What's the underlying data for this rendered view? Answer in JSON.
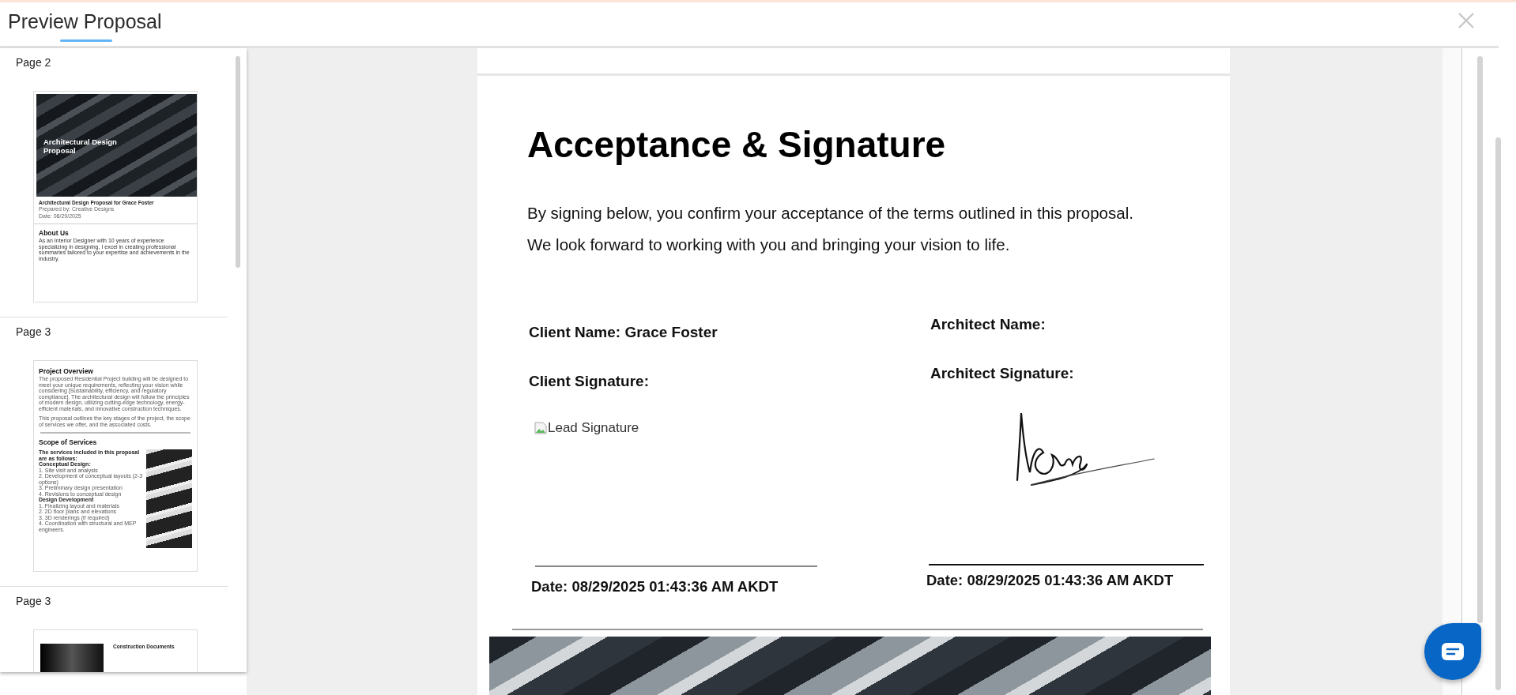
{
  "window": {
    "title": "Preview Proposal"
  },
  "sidebar": {
    "thumbnails": [
      {
        "label": "Page 2",
        "kind": "cover",
        "photo_title": "Architectural Design Proposal",
        "doc_title": "Architectural Design Proposal for Grace Foster",
        "meta": [
          "Prepared by: Creative Designs",
          "Date: 08/29/2025"
        ],
        "section_title": "About Us",
        "section_text": "As an Interior Designer with 10 years of experience specializing in designing, I excel in creating professional summaries tailored to your expertise and achievements in the industry."
      },
      {
        "label": "Page 3",
        "kind": "overview",
        "title": "Project Overview",
        "paragraphs": [
          "The proposed Residential Project building will be designed to meet your unique requirements, reflecting your vision while considering [Sustainability, efficiency, and regulatory compliance]. The architectural design will follow the principles of modern design, utilizing cutting-edge technology, energy-efficient materials, and innovative construction techniques.",
          "This proposal outlines the key stages of the project, the scope of services we offer, and the associated costs."
        ],
        "section_title": "Scope of Services",
        "intro": "The services included in this proposal are as follows:",
        "groups": [
          {
            "heading": "Conceptual Design:",
            "items": [
              "1. Site visit and analysis",
              "2. Development of conceptual layouts (2-3 options)",
              "3. Preliminary design presentation",
              "4. Revisions to conceptual design"
            ]
          },
          {
            "heading": "Design Development",
            "items": [
              "1. Finalizing layout and materials",
              "2. 2D floor plans and elevations",
              "3. 3D renderings (if required)",
              "4. Coordination with structural and MEP engineers."
            ]
          }
        ]
      },
      {
        "label": "Page 3",
        "kind": "construction",
        "heading": "Construction Documents"
      }
    ]
  },
  "document": {
    "heading": "Acceptance & Signature",
    "paragraphs": [
      "By signing below, you confirm your acceptance of the terms outlined in this proposal.",
      "We look forward to working with you and bringing your vision to life."
    ],
    "signers": [
      {
        "name_label": "Client Name: Grace Foster",
        "signature_label": "Client Signature:",
        "signature": {
          "kind": "broken-image",
          "alt": "Lead Signature"
        },
        "date": "Date: 08/29/2025 01:43:36 AM AKDT"
      },
      {
        "name_label": "Architect Name:",
        "signature_label": "Architect Signature:",
        "signature": {
          "kind": "drawn"
        },
        "date": "Date: 08/29/2025 01:43:36 AM AKDT"
      }
    ]
  }
}
